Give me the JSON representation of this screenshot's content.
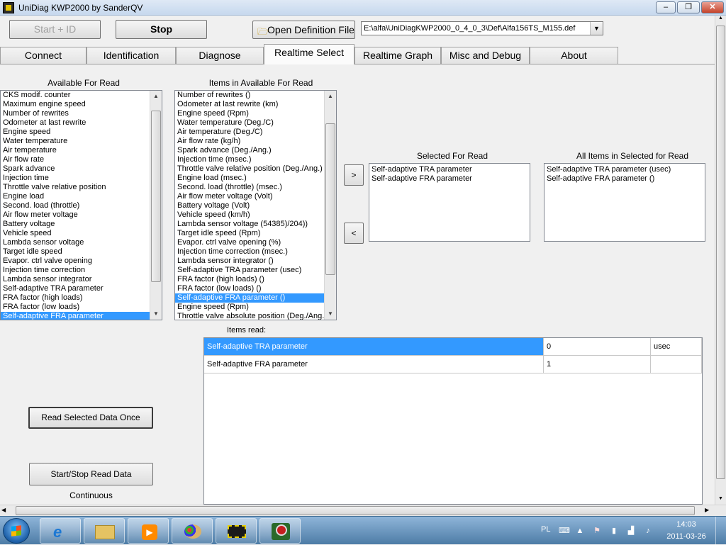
{
  "window": {
    "title": "UniDiag KWP2000 by SanderQV",
    "minimize": "‒",
    "maximize": "❐",
    "close": "✕"
  },
  "toolbar": {
    "start_id_label": "Start + ID",
    "stop_label": "Stop",
    "open_def_label": "Open Definition File",
    "def_path": "E:\\alfa\\UniDiagKWP2000_0_4_0_3\\Def\\Alfa156TS_M155.def"
  },
  "tabs": [
    {
      "label": "Connect"
    },
    {
      "label": "Identification"
    },
    {
      "label": "Diagnose"
    },
    {
      "label": "Realtime Select"
    },
    {
      "label": "Realtime Graph"
    },
    {
      "label": "Misc and Debug"
    },
    {
      "label": "About"
    }
  ],
  "available": {
    "header": "Available For Read",
    "items": [
      "CKS modif. counter",
      "Maximum engine speed",
      "Number of rewrites",
      "Odometer at last rewrite",
      "Engine speed",
      "Water temperature",
      "Air temperature",
      "Air flow rate",
      "Spark advance",
      "Injection time",
      "Throttle valve relative position",
      "Engine load",
      "Second. load (throttle)",
      "Air flow meter voltage",
      "Battery voltage",
      "Vehicle speed",
      "Lambda sensor voltage",
      "Target idle speed",
      "Evapor. ctrl valve opening",
      "Injection time correction",
      "Lambda sensor integrator",
      "Self-adaptive TRA parameter",
      "FRA factor (high loads)",
      "FRA factor (low loads)",
      "Self-adaptive FRA parameter"
    ],
    "selected_index": 24
  },
  "items_available": {
    "header": "Items in Available For Read",
    "items": [
      "Number of rewrites ()",
      "Odometer at last rewrite (km)",
      "Engine speed (Rpm)",
      "Water temperature (Deg./C)",
      "Air temperature (Deg./C)",
      "Air flow rate (kg/h)",
      "Spark advance (Deg./Ang.)",
      "Injection time (msec.)",
      "Throttle valve relative position (Deg./Ang.)",
      "Engine load (msec.)",
      "Second. load (throttle) (msec.)",
      "Air flow meter voltage (Volt)",
      "Battery voltage (Volt)",
      "Vehicle speed (km/h)",
      "Lambda sensor voltage (54385)/204))",
      "Target idle speed (Rpm)",
      "Evapor. ctrl valve opening (%)",
      "Injection time correction (msec.)",
      "Lambda sensor integrator ()",
      "Self-adaptive TRA parameter (usec)",
      "FRA factor (high loads) ()",
      "FRA factor (low loads) ()",
      "Self-adaptive FRA parameter ()",
      "Engine speed (Rpm)",
      "Throttle valve absolute position (Deg./Ang.)"
    ],
    "selected_index": 22
  },
  "selected_for_read": {
    "header": "Selected For Read",
    "items": [
      "Self-adaptive TRA parameter",
      "Self-adaptive FRA parameter"
    ]
  },
  "all_selected": {
    "header": "All Items in Selected for Read",
    "items": [
      "Self-adaptive TRA parameter (usec)",
      "Self-adaptive FRA parameter ()"
    ]
  },
  "move_right_label": ">",
  "move_left_label": "<",
  "items_read": {
    "header": "Items read:",
    "rows": [
      {
        "name": "Self-adaptive TRA parameter",
        "value": "0",
        "unit": "usec"
      },
      {
        "name": "Self-adaptive FRA parameter",
        "value": "1",
        "unit": ""
      }
    ]
  },
  "actions": {
    "read_once_label": "Read Selected Data Once",
    "read_continuous_label": "Start/Stop Read Data Continuous"
  },
  "taskbar": {
    "language": "PL",
    "time": "14:03",
    "date": "2011-03-26",
    "apps": [
      "internet-explorer-icon",
      "file-explorer-icon",
      "media-player-icon",
      "paint-icon",
      "unidiag-chip-icon",
      "fiat-diag-icon"
    ]
  },
  "colors": {
    "selection": "#3399ff",
    "taskbar": "#4d7ca6"
  }
}
